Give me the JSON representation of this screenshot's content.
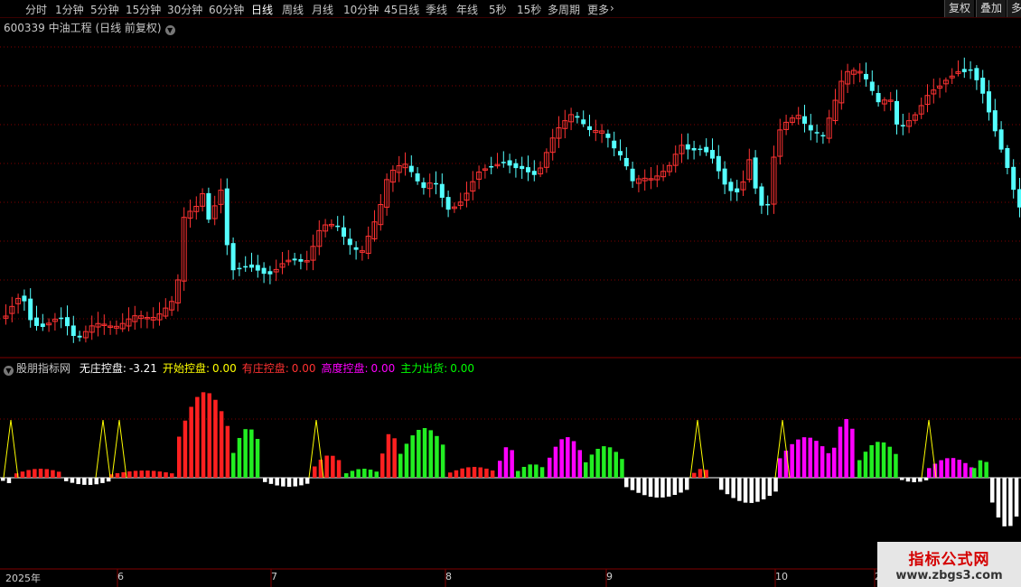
{
  "toolbar": {
    "periods": [
      {
        "label": "分时",
        "active": false
      },
      {
        "label": "1分钟",
        "active": false
      },
      {
        "label": "5分钟",
        "active": false
      },
      {
        "label": "15分钟",
        "active": false
      },
      {
        "label": "30分钟",
        "active": false
      },
      {
        "label": "60分钟",
        "active": false
      },
      {
        "label": "日线",
        "active": true
      },
      {
        "label": "周线",
        "active": false
      },
      {
        "label": "月线",
        "active": false
      },
      {
        "label": "10分钟",
        "active": false
      },
      {
        "label": "45日线",
        "active": false
      },
      {
        "label": "季线",
        "active": false
      },
      {
        "label": "年线",
        "active": false
      },
      {
        "label": "5秒",
        "active": false
      },
      {
        "label": "15秒",
        "active": false
      },
      {
        "label": "多周期",
        "active": false
      },
      {
        "label": "更多",
        "active": false
      }
    ],
    "more_arrow": "›",
    "right_buttons": [
      "复权",
      "叠加",
      "多"
    ]
  },
  "chart": {
    "title": "600339 中油工程 (日线 前复权)",
    "colors": {
      "up": "#ff3232",
      "down": "#54ffff",
      "grid": "#800000",
      "axis": "#800000"
    }
  },
  "indicator": {
    "name": "股朋指标网",
    "items": [
      {
        "label": "无庄控盘:",
        "value": "-3.21",
        "color": "#ffffff"
      },
      {
        "label": "开始控盘:",
        "value": "0.00",
        "color": "#ffff00"
      },
      {
        "label": "有庄控盘:",
        "value": "0.00",
        "color": "#ff3232"
      },
      {
        "label": "高度控盘:",
        "value": "0.00",
        "color": "#ff00ff"
      },
      {
        "label": "主力出货:",
        "value": "0.00",
        "color": "#00ff00"
      }
    ]
  },
  "date_axis": [
    "2025年",
    "6",
    "7",
    "8",
    "9",
    "10",
    "2"
  ],
  "watermark": {
    "line1": "指标公式网",
    "line2": "www.zbgs3.com"
  }
}
